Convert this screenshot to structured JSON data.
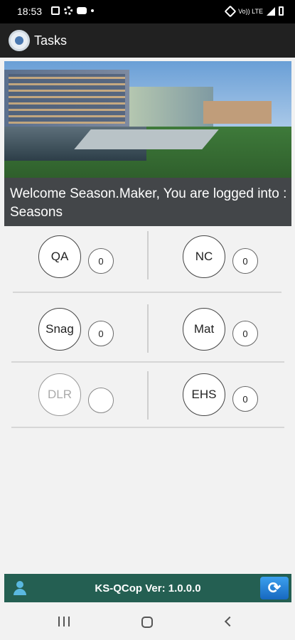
{
  "status_bar": {
    "time": "18:53",
    "icons": [
      "gallery-icon",
      "settings-icon",
      "youtube-icon",
      "dot-icon",
      "mute-icon",
      "wifi-icon",
      "signal-icon",
      "battery-icon"
    ],
    "wifi_label": "Vo)) LTE"
  },
  "header": {
    "title": "Tasks",
    "logo_icon": "qcop-logo-icon"
  },
  "banner": {
    "welcome_text": "Welcome Season.Maker, You are logged into : Seasons"
  },
  "tiles": [
    {
      "label": "QA",
      "count": "0",
      "enabled": true
    },
    {
      "label": "NC",
      "count": "0",
      "enabled": true
    },
    {
      "label": "Snag",
      "count": "0",
      "enabled": true
    },
    {
      "label": "Mat",
      "count": "0",
      "enabled": true
    },
    {
      "label": "DLR",
      "count": "",
      "enabled": false
    },
    {
      "label": "EHS",
      "count": "0",
      "enabled": true
    }
  ],
  "footer": {
    "version_text": "KS-QCop Ver: 1.0.0.0",
    "user_icon": "user-icon",
    "refresh_icon": "refresh-icon",
    "colors": {
      "background": "#245f52",
      "refresh": "#2a86dc"
    }
  },
  "nav": {
    "recent_icon": "recent-apps-icon",
    "home_icon": "home-icon",
    "back_icon": "back-icon"
  }
}
